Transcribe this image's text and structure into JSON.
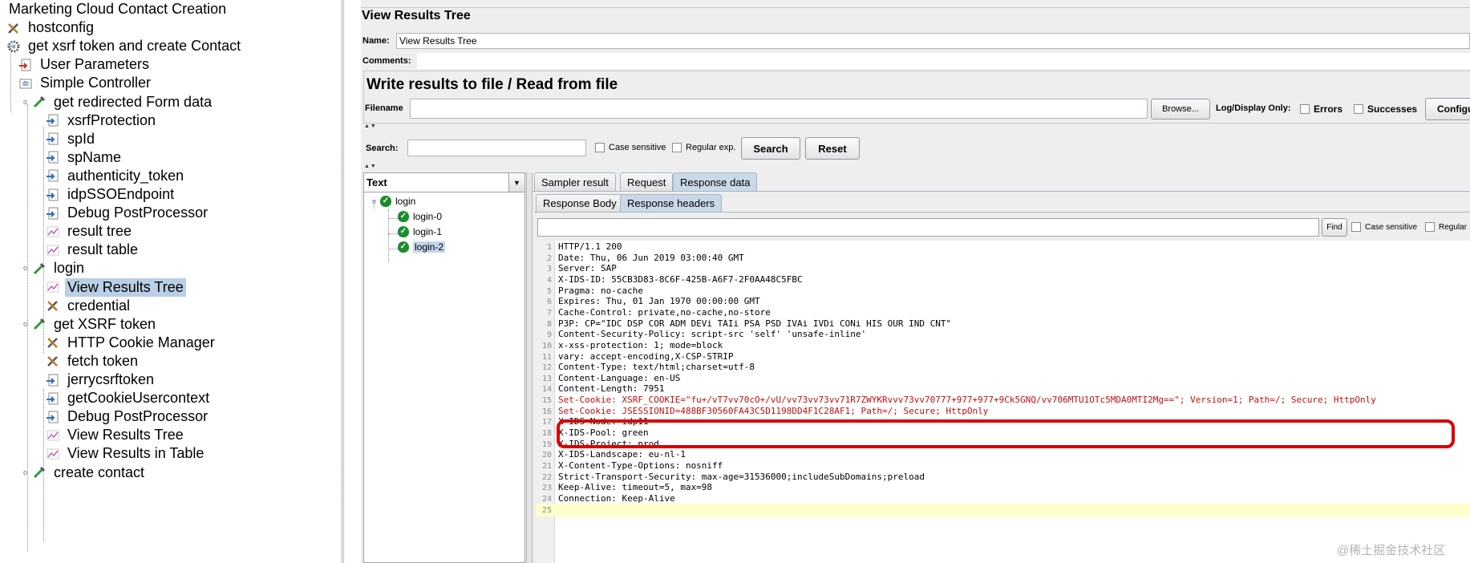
{
  "left_tree": {
    "items": [
      {
        "label": "Marketing Cloud Contact Creation",
        "icon": "testplan-icon"
      },
      {
        "label": "hostconfig",
        "icon": "wrench-icon"
      },
      {
        "label": "get xsrf token and create Contact",
        "icon": "gear-icon"
      },
      {
        "label": "User Parameters",
        "icon": "preprocessor-icon"
      },
      {
        "label": "Simple Controller",
        "icon": "controller-icon"
      },
      {
        "label": "get redirected Form data",
        "icon": "pipette-icon"
      },
      {
        "label": "xsrfProtection",
        "icon": "extractor-icon"
      },
      {
        "label": "spId",
        "icon": "extractor-icon"
      },
      {
        "label": "spName",
        "icon": "extractor-icon"
      },
      {
        "label": "authenticity_token",
        "icon": "extractor-icon"
      },
      {
        "label": "idpSSOEndpoint",
        "icon": "extractor-icon"
      },
      {
        "label": "Debug PostProcessor",
        "icon": "extractor-icon"
      },
      {
        "label": "result tree",
        "icon": "listener-icon"
      },
      {
        "label": "result table",
        "icon": "listener-icon"
      },
      {
        "label": "login",
        "icon": "pipette-icon"
      },
      {
        "label": "View Results Tree",
        "icon": "listener-icon"
      },
      {
        "label": "credential",
        "icon": "wrench-icon"
      },
      {
        "label": "get XSRF token",
        "icon": "pipette-icon"
      },
      {
        "label": "HTTP Cookie Manager",
        "icon": "wrench-icon"
      },
      {
        "label": "fetch token",
        "icon": "wrench-icon"
      },
      {
        "label": "jerrycsrftoken",
        "icon": "extractor-icon"
      },
      {
        "label": "getCookieUsercontext",
        "icon": "extractor-icon"
      },
      {
        "label": "Debug PostProcessor",
        "icon": "extractor-icon"
      },
      {
        "label": "View Results Tree",
        "icon": "listener-icon"
      },
      {
        "label": "View Results in Table",
        "icon": "listener-icon"
      },
      {
        "label": "create contact",
        "icon": "pipette-icon"
      }
    ]
  },
  "panel": {
    "title": "View Results Tree",
    "name_label": "Name:",
    "name_value": "View Results Tree",
    "comments_label": "Comments:",
    "write_title": "Write results to file / Read from file",
    "filename_label": "Filename",
    "browse_label": "Browse...",
    "log_display_label": "Log/Display Only:",
    "errors_label": "Errors",
    "successes_label": "Successes",
    "configure_label": "Configu",
    "search_label": "Search:",
    "case_sensitive_label": "Case sensitive",
    "regex_label": "Regular exp.",
    "search_button": "Search",
    "reset_button": "Reset"
  },
  "results": {
    "renderer": "Text",
    "tree": [
      {
        "label": "login"
      },
      {
        "label": "login-0"
      },
      {
        "label": "login-1"
      },
      {
        "label": "login-2"
      }
    ],
    "tabs": [
      "Sampler result",
      "Request",
      "Response data"
    ],
    "subtabs": [
      "Response Body",
      "Response headers"
    ],
    "find_button": "Find",
    "find_case": "Case sensitive",
    "find_regex": "Regular"
  },
  "code_lines": [
    "HTTP/1.1 200",
    "Date: Thu, 06 Jun 2019 03:00:40 GMT",
    "Server: SAP",
    "X-IDS-ID: 55CB3D83-8C6F-425B-A6F7-2F0AA48C5FBC",
    "Pragma: no-cache",
    "Expires: Thu, 01 Jan 1970 00:00:00 GMT",
    "Cache-Control: private,no-cache,no-store",
    "P3P: CP=\"IDC DSP COR ADM DEVi TAIi PSA PSD IVAi IVDi CONi HIS OUR IND CNT\"",
    "Content-Security-Policy: script-src 'self' 'unsafe-inline'",
    "x-xss-protection: 1; mode=block",
    "vary: accept-encoding,X-CSP-STRIP",
    "Content-Type: text/html;charset=utf-8",
    "Content-Language: en-US",
    "Content-Length: 7951",
    "Set-Cookie: XSRF_COOKIE=\"fu+/vT7vv70cO+/vU/vv73vv73vv71R7ZWYKRvvv73vv70777+977+977+9Ck5GNQ/vv706MTU1OTc5MDA0MTI2Mg==\"; Version=1; Path=/; Secure; HttpOnly",
    "Set-Cookie: JSESSIONID=488BF30560FA43C5D1198DD4F1C28AF1; Path=/; Secure; HttpOnly",
    "X-IDS-Node: idp11",
    "X-IDS-Pool: green",
    "X-IDS-Project: prod",
    "X-IDS-Landscape: eu-nl-1",
    "X-Content-Type-Options: nosniff",
    "Strict-Transport-Security: max-age=31536000;includeSubDomains;preload",
    "Keep-Alive: timeout=5, max=98",
    "Connection: Keep-Alive",
    ""
  ],
  "watermark": "@稀土掘金技术社区",
  "colors": {
    "highlight": "#d70000",
    "selection": "#b8cfe5",
    "shield": "#1c8d2c"
  }
}
